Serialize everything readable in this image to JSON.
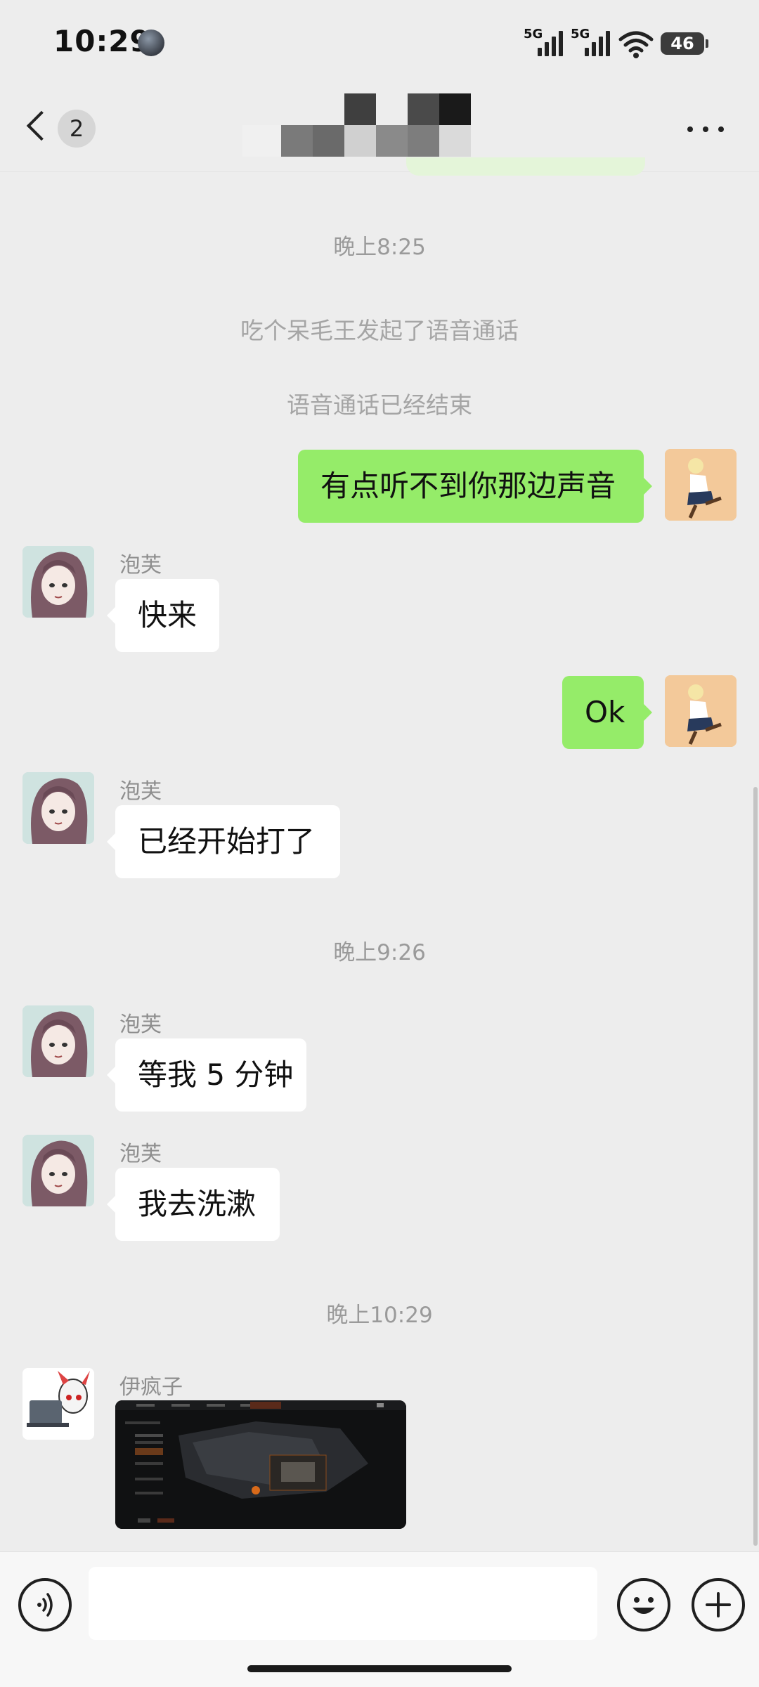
{
  "status_bar": {
    "time": "10:29",
    "signal1": "5G",
    "signal2": "5G",
    "battery": "46",
    "icons": [
      "user-avatar-icon",
      "signal-icon",
      "signal-icon",
      "wifi-icon",
      "battery-icon"
    ]
  },
  "header": {
    "back_icon": "chevron-left-icon",
    "unread_count": "2",
    "title": "(pixelated / redacted chat name)",
    "more_icon": "more-dots-icon"
  },
  "messages": {
    "ts1": "晚上8:25",
    "sys1": "吃个呆毛王发起了语音通话",
    "sys2": "语音通话已经结束",
    "m1": "有点听不到你那边声音",
    "m2_name": "泡芙",
    "m2": "快来",
    "m3": "Ok",
    "m4_name": "泡芙",
    "m4": "已经开始打了",
    "ts2": "晚上9:26",
    "m5_name": "泡芙",
    "m5": "等我 5 分钟",
    "m6_name": "泡芙",
    "m6": "我去洗漱",
    "ts3": "晚上10:29",
    "m7_name": "伊疯子",
    "m7_image": "game-map-screenshot"
  },
  "bottom_bar": {
    "voice_icon": "voice-input-icon",
    "input_placeholder": "",
    "emoji_icon": "emoji-icon",
    "plus_icon": "plus-icon"
  },
  "colors": {
    "background": "#ededed",
    "own_bubble": "#95ec69",
    "other_bubble": "#ffffff",
    "secondary_text": "#9a9a9a"
  }
}
